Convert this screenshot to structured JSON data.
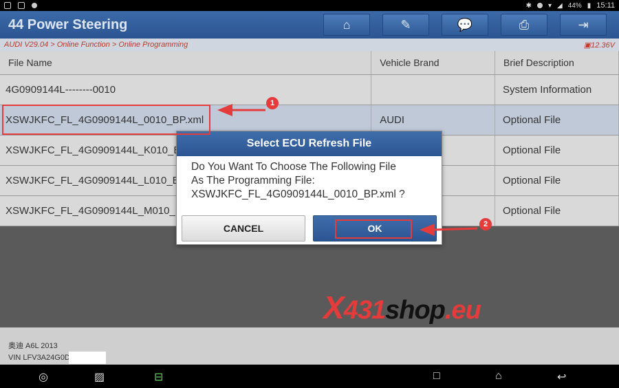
{
  "status_bar": {
    "battery": "44%",
    "time": "15:11"
  },
  "header": {
    "title": "44 Power Steering",
    "toolbar_icons": [
      "home-icon",
      "edit-report-icon",
      "message-icon",
      "print-icon",
      "exit-icon"
    ]
  },
  "breadcrumb": {
    "path": "AUDI V29.04 > Online Function > Online Programming",
    "voltage": "12.36V"
  },
  "table": {
    "headers": [
      "File Name",
      "Vehicle Brand",
      "Brief Description"
    ],
    "rows": [
      {
        "file": "4G0909144L--------0010",
        "brand": "",
        "desc": "System Information"
      },
      {
        "file": "XSWJKFC_FL_4G0909144L_0010_BP.xml",
        "brand": "AUDI",
        "desc": "Optional File"
      },
      {
        "file": "XSWJKFC_FL_4G0909144L_K010_BP.xml",
        "brand": "AUDI",
        "desc": "Optional File"
      },
      {
        "file": "XSWJKFC_FL_4G0909144L_L010_BP.xml",
        "brand": "AUDI",
        "desc": "Optional File"
      },
      {
        "file": "XSWJKFC_FL_4G0909144L_M010_BP.xml",
        "brand": "AUDI",
        "desc": "Optional File"
      }
    ]
  },
  "vehicle": {
    "model": "奥迪 A6L 2013",
    "vin_prefix": "VIN LFV3A24G0D"
  },
  "dialog": {
    "title": "Select ECU Refresh File",
    "line1": "Do You Want To Choose The Following File",
    "line2": "As The Programming File:",
    "line3": "XSWJKFC_FL_4G0909144L_0010_BP.xml ?",
    "cancel_label": "CANCEL",
    "ok_label": "OK"
  },
  "annotations": {
    "step1": "1",
    "step2": "2"
  },
  "watermark": {
    "x": "X",
    "num": "431",
    "shop": "shop",
    "eu": ".eu"
  },
  "colors": {
    "header_blue": "#2b5592",
    "highlight_red": "#e53b3b",
    "selected_row": "#bfc9d8"
  }
}
